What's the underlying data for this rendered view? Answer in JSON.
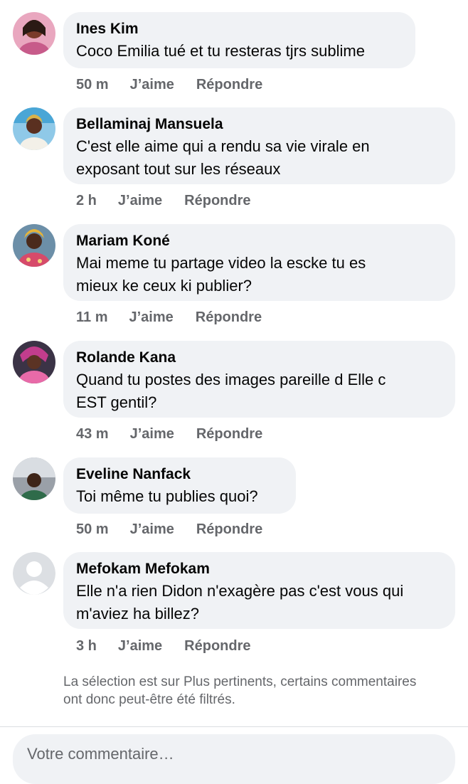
{
  "comments": [
    {
      "author": "Ines Kim",
      "lines": [
        "Coco Emilia tué et tu resteras tjrs sublime"
      ],
      "time": "50 m",
      "like": "J’aime",
      "reply": "Répondre",
      "avatar": "avatar-photo"
    },
    {
      "author": "Bellaminaj Mansuela",
      "lines": [
        "C'est  elle aime qui a rendu sa vie virale  en",
        "exposant tout sur les réseaux"
      ],
      "time": "2 h",
      "like": "J’aime",
      "reply": "Répondre",
      "avatar": "avatar-photo"
    },
    {
      "author": "Mariam Koné",
      "lines": [
        "Mai meme tu partage video la escke tu es",
        "mieux ke ceux ki publier?"
      ],
      "time": "11 m",
      "like": "J’aime",
      "reply": "Répondre",
      "avatar": "avatar-photo"
    },
    {
      "author": "Rolande Kana",
      "lines": [
        "Quand tu postes des images pareille d Elle c",
        "EST gentil?"
      ],
      "time": "43 m",
      "like": "J’aime",
      "reply": "Répondre",
      "avatar": "avatar-photo"
    },
    {
      "author": "Eveline Nanfack",
      "lines": [
        "Toi même tu publies quoi?"
      ],
      "time": "50 m",
      "like": "J’aime",
      "reply": "Répondre",
      "avatar": "avatar-photo"
    },
    {
      "author": "Mefokam Mefokam",
      "lines": [
        "Elle n'a rien Didon n'exagère pas c'est vous qui",
        "m'aviez ha billez?"
      ],
      "time": "3 h",
      "like": "J’aime",
      "reply": "Répondre",
      "avatar": "default-avatar-icon"
    }
  ],
  "footer_note": "La sélection est sur Plus pertinents, certains commentaires ont donc peut-être été filtrés.",
  "composer": {
    "placeholder": "Votre commentaire…"
  },
  "colors": {
    "bubble": "#f0f2f5",
    "secondary_text": "#65676b",
    "primary_text": "#050505"
  }
}
